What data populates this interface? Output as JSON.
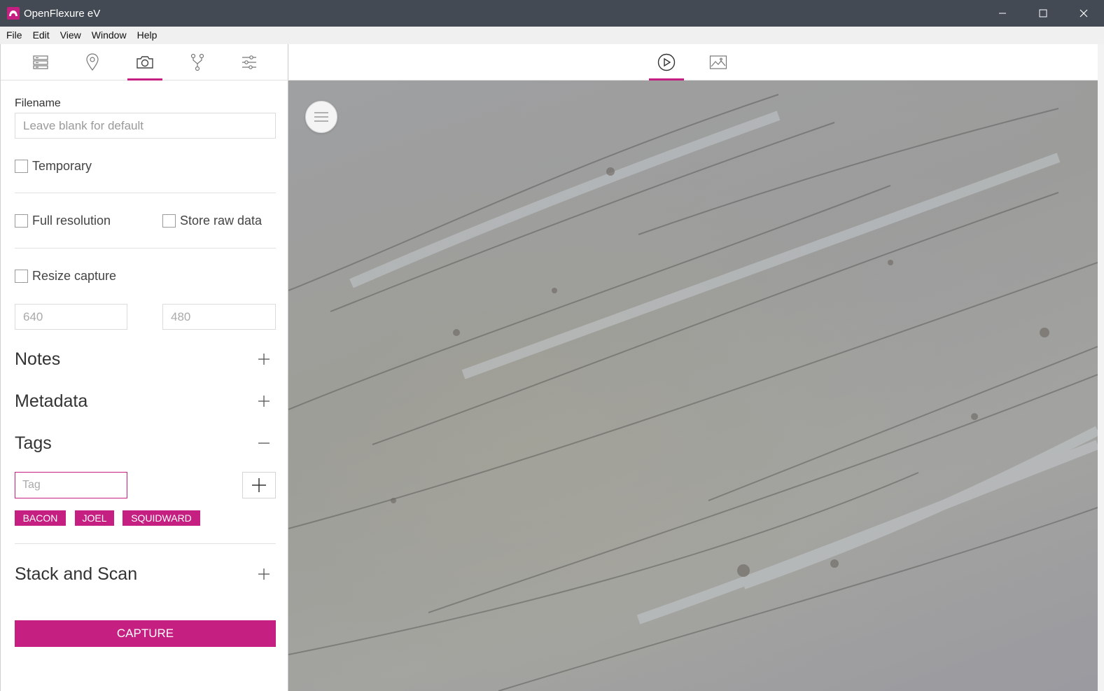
{
  "window": {
    "title": "OpenFlexure eV",
    "app_icon": "openflexure-logo-icon",
    "controls": [
      "minimize-icon",
      "maximize-icon",
      "close-icon"
    ]
  },
  "menubar": {
    "items": [
      {
        "label": "File"
      },
      {
        "label": "Edit"
      },
      {
        "label": "View"
      },
      {
        "label": "Window"
      },
      {
        "label": "Help"
      }
    ]
  },
  "sidebar": {
    "tabs": [
      {
        "icon": "storage-icon",
        "active": false
      },
      {
        "icon": "location-pin-icon",
        "active": false
      },
      {
        "icon": "camera-icon",
        "active": true
      },
      {
        "icon": "fork-icon",
        "active": false
      },
      {
        "icon": "sliders-icon",
        "active": false
      }
    ],
    "filename": {
      "label": "Filename",
      "placeholder": "Leave blank for default",
      "value": ""
    },
    "temporary": {
      "label": "Temporary",
      "checked": false
    },
    "full_resolution": {
      "label": "Full resolution",
      "checked": false
    },
    "store_raw_data": {
      "label": "Store raw data",
      "checked": false
    },
    "resize_capture": {
      "label": "Resize capture",
      "checked": false,
      "width_placeholder": "640",
      "height_placeholder": "480"
    },
    "sections": {
      "notes": {
        "title": "Notes",
        "expanded": false
      },
      "metadata": {
        "title": "Metadata",
        "expanded": false
      },
      "tags": {
        "title": "Tags",
        "expanded": true
      },
      "stack_and_scan": {
        "title": "Stack and Scan",
        "expanded": false
      }
    },
    "tag_input": {
      "placeholder": "Tag",
      "value": ""
    },
    "tags": [
      "BACON",
      "JOEL",
      "SQUIDWARD"
    ],
    "capture_label": "CAPTURE"
  },
  "main": {
    "tabs": [
      {
        "icon": "play-circle-icon",
        "active": true
      },
      {
        "icon": "gallery-image-icon",
        "active": false
      }
    ],
    "menu_button_icon": "hamburger-icon"
  },
  "colors": {
    "accent": "#c51f82",
    "titlebar": "#434a54",
    "menubar": "#f0f0f0"
  }
}
